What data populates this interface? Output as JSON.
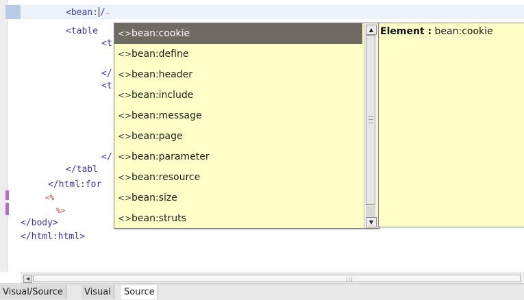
{
  "editor": {
    "lines": [
      {
        "text": "<bean:",
        "after_caret": "/",
        "ghost": "→"
      },
      {
        "text": "<table"
      },
      {
        "text": "<t"
      },
      {
        "text": "</"
      },
      {
        "text": "<t"
      },
      {
        "text": "</"
      },
      {
        "text": "</tabl"
      },
      {
        "text": "</html:for"
      },
      {
        "text": "<%"
      },
      {
        "text": "%>"
      },
      {
        "text": "</body>"
      },
      {
        "text": "</html:html>"
      }
    ]
  },
  "completion": {
    "items": [
      {
        "icon": "<>",
        "label": "bean:cookie",
        "selected": true
      },
      {
        "icon": "<>",
        "label": "bean:define"
      },
      {
        "icon": "<>",
        "label": "bean:header"
      },
      {
        "icon": "<>",
        "label": "bean:include"
      },
      {
        "icon": "<>",
        "label": "bean:message"
      },
      {
        "icon": "<>",
        "label": "bean:page"
      },
      {
        "icon": "<>",
        "label": "bean:parameter"
      },
      {
        "icon": "<>",
        "label": "bean:resource"
      },
      {
        "icon": "<>",
        "label": "bean:size"
      },
      {
        "icon": "<>",
        "label": "bean:struts"
      }
    ],
    "scroll_up_icon": "▲",
    "scroll_down_icon": "▼",
    "info": {
      "label": "Element :",
      "value": "bean:cookie"
    }
  },
  "hscroll": {
    "left_icon": "◀",
    "grip": "|||"
  },
  "tabs": [
    {
      "label": "Visual/Source"
    },
    {
      "label": "Visual"
    },
    {
      "label": "Source",
      "active": true
    }
  ],
  "colors": {
    "popup_bg": "#ffffc8",
    "selected_bg": "#6f6a62",
    "tag_color": "#3a3aa3",
    "jsp_color": "#c0392b",
    "marker_color": "#b06fc7"
  }
}
